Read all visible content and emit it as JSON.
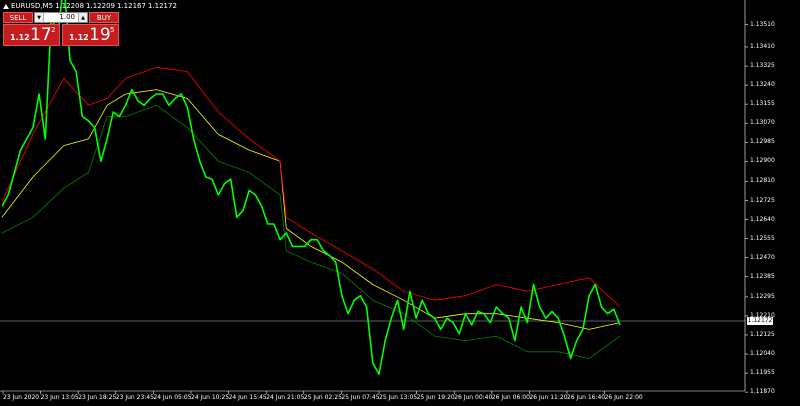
{
  "title": {
    "symbol": "EURUSD,M5",
    "open": "1.12208",
    "high": "1.12209",
    "low": "1.12167",
    "close": "1.12172"
  },
  "trade_panel": {
    "sell_label": "SELL",
    "buy_label": "BUY",
    "lot_value": "1.00",
    "sell_price": {
      "prefix": "1.12",
      "big": "17",
      "sup": "2"
    },
    "buy_price": {
      "prefix": "1.12",
      "big": "19",
      "sup": "5"
    }
  },
  "current_price_label": "1.12172",
  "colors": {
    "background": "#000000",
    "price": "#00ff00",
    "upper_band": "#ff0000",
    "middle_band": "#ffff00",
    "lower_band": "#008000",
    "axis": "#ffffff",
    "trade_button": "#c51d1d"
  },
  "chart_data": {
    "type": "line",
    "symbol": "EURUSD",
    "timeframe": "M5",
    "ylim": [
      1.11875,
      1.13575
    ],
    "y_ticks": [
      "1.13510",
      "1.13410",
      "1.13325",
      "1.13240",
      "1.13155",
      "1.13070",
      "1.12985",
      "1.12900",
      "1.12810",
      "1.12725",
      "1.12640",
      "1.12555",
      "1.12470",
      "1.12385",
      "1.12295",
      "1.12210",
      "1.12125",
      "1.12040",
      "1.11955",
      "1.11870"
    ],
    "x_ticks": [
      "23 Jun 2020",
      "23 Jun 13:05",
      "23 Jun 18:25",
      "23 Jun 23:45",
      "24 Jun 05:05",
      "24 Jun 10:25",
      "24 Jun 15:45",
      "24 Jun 21:05",
      "25 Jun 02:25",
      "25 Jun 07:45",
      "25 Jun 13:05",
      "25 Jun 19:20",
      "26 Jun 00:40",
      "26 Jun 06:00",
      "26 Jun 11:20",
      "26 Jun 16:40",
      "26 Jun 22:00"
    ],
    "x_index_range": [
      0,
      100
    ],
    "current_price": 1.12172,
    "series": [
      {
        "name": "price",
        "x": [
          0,
          1,
          2,
          3,
          4,
          5,
          6,
          7,
          8,
          9,
          10,
          11,
          12,
          13,
          14,
          15,
          16,
          17,
          18,
          19,
          20,
          21,
          22,
          23,
          24,
          25,
          26,
          27,
          28,
          29,
          30,
          31,
          32,
          33,
          34,
          35,
          36,
          37,
          38,
          39,
          40,
          41,
          42,
          43,
          44,
          45,
          46,
          47,
          48,
          49,
          50,
          51,
          52,
          53,
          54,
          55,
          56,
          57,
          58,
          59,
          60,
          61,
          62,
          63,
          64,
          65,
          66,
          67,
          68,
          69,
          70,
          71,
          72,
          73,
          74,
          75,
          76,
          77,
          78,
          79,
          80,
          81,
          82,
          83,
          84,
          85,
          86,
          87,
          88,
          89,
          90,
          91,
          92,
          93,
          94,
          95,
          96,
          97,
          98,
          99,
          100
        ],
        "y": [
          1.127,
          1.1275,
          1.1285,
          1.1295,
          1.13,
          1.1305,
          1.132,
          1.13,
          1.1355,
          1.1345,
          1.137,
          1.1335,
          1.133,
          1.131,
          1.1308,
          1.1305,
          1.129,
          1.13,
          1.1312,
          1.131,
          1.1315,
          1.1322,
          1.1317,
          1.1315,
          1.1318,
          1.132,
          1.132,
          1.1315,
          1.1318,
          1.132,
          1.1314,
          1.13,
          1.129,
          1.1283,
          1.1282,
          1.1275,
          1.128,
          1.1282,
          1.1265,
          1.1268,
          1.1277,
          1.1275,
          1.127,
          1.1262,
          1.1262,
          1.1255,
          1.1258,
          1.1252,
          1.1252,
          1.1252,
          1.1255,
          1.1255,
          1.125,
          1.1248,
          1.1245,
          1.123,
          1.1222,
          1.1228,
          1.123,
          1.1225,
          1.12,
          1.1195,
          1.121,
          1.122,
          1.1228,
          1.1215,
          1.1232,
          1.122,
          1.1228,
          1.1222,
          1.122,
          1.1215,
          1.122,
          1.1218,
          1.1213,
          1.1222,
          1.1217,
          1.1223,
          1.1222,
          1.1218,
          1.1225,
          1.1222,
          1.122,
          1.121,
          1.1225,
          1.1218,
          1.1235,
          1.1225,
          1.122,
          1.1223,
          1.122,
          1.1212,
          1.1202,
          1.121,
          1.1215,
          1.123,
          1.1235,
          1.1225,
          1.1222,
          1.1224,
          1.1217
        ]
      },
      {
        "name": "upper",
        "x": [
          0,
          5,
          10,
          14,
          17,
          20,
          25,
          30,
          35,
          40,
          45,
          46,
          50,
          55,
          60,
          65,
          70,
          75,
          80,
          85,
          90,
          95,
          100
        ],
        "y": [
          1.1272,
          1.1302,
          1.1327,
          1.1315,
          1.1318,
          1.1327,
          1.1332,
          1.133,
          1.1312,
          1.13,
          1.129,
          1.1265,
          1.1258,
          1.125,
          1.1242,
          1.1232,
          1.1228,
          1.123,
          1.1235,
          1.1232,
          1.1235,
          1.1238,
          1.1225
        ]
      },
      {
        "name": "middle",
        "x": [
          0,
          5,
          10,
          14,
          17,
          20,
          25,
          30,
          35,
          40,
          45,
          46,
          50,
          55,
          60,
          65,
          70,
          75,
          80,
          85,
          90,
          95,
          100
        ],
        "y": [
          1.1265,
          1.1283,
          1.1297,
          1.13,
          1.1315,
          1.132,
          1.1322,
          1.1318,
          1.1302,
          1.1295,
          1.129,
          1.126,
          1.1252,
          1.1245,
          1.1235,
          1.1228,
          1.122,
          1.1222,
          1.1222,
          1.122,
          1.1218,
          1.1215,
          1.1218
        ]
      },
      {
        "name": "lower",
        "x": [
          0,
          5,
          10,
          14,
          17,
          20,
          25,
          30,
          35,
          40,
          45,
          46,
          50,
          55,
          60,
          65,
          70,
          75,
          80,
          85,
          90,
          95,
          100
        ],
        "y": [
          1.1258,
          1.1265,
          1.1278,
          1.1285,
          1.131,
          1.131,
          1.1315,
          1.1305,
          1.129,
          1.1285,
          1.1275,
          1.125,
          1.1245,
          1.124,
          1.1228,
          1.1222,
          1.1212,
          1.121,
          1.1212,
          1.1205,
          1.1205,
          1.1202,
          1.1212
        ]
      }
    ]
  }
}
